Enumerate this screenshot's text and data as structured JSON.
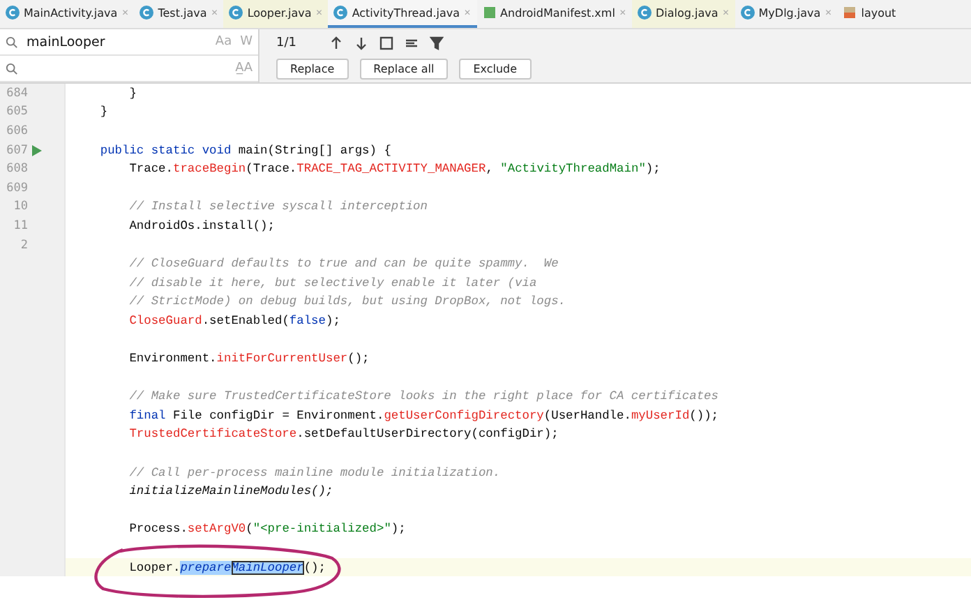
{
  "tabs": [
    {
      "label": "MainActivity.java",
      "kind": "class",
      "selected": false,
      "color": "#f2f2f2",
      "close": "✕"
    },
    {
      "label": "Test.java",
      "kind": "class",
      "selected": false,
      "color": "#f2f2f2",
      "close": "✕"
    },
    {
      "label": "Looper.java",
      "kind": "class",
      "selected": false,
      "color": "#f3f3dc",
      "close": "✕"
    },
    {
      "label": "ActivityThread.java",
      "kind": "class",
      "selected": true,
      "color": "#f6f6f6",
      "close": "✕"
    },
    {
      "label": "AndroidManifest.xml",
      "kind": "manifest",
      "selected": false,
      "color": "#f2f2f2",
      "close": "✕"
    },
    {
      "label": "Dialog.java",
      "kind": "class",
      "selected": false,
      "color": "#f3f3dc",
      "close": "✕"
    },
    {
      "label": "MyDlg.java",
      "kind": "class",
      "selected": false,
      "color": "#f2f2f2",
      "close": "✕"
    },
    {
      "label": "layout",
      "kind": "layout",
      "selected": false,
      "color": "#f2f2f2"
    }
  ],
  "find": {
    "value": "mainLooper",
    "count": "1/1",
    "options": [
      "Aa",
      "W"
    ]
  },
  "replace": {
    "options": [
      "A̲A"
    ],
    "buttons": [
      "Replace",
      "Replace all",
      "Exclude"
    ]
  },
  "lines": [
    {
      "kind": "code",
      "number": "684",
      "code": [
        {
          "text": "        }",
          "kind": "plain"
        }
      ]
    },
    {
      "kind": "code",
      "number": "605",
      "code": [
        {
          "text": "    }",
          "kind": "plain"
        }
      ]
    },
    {
      "kind": "blank",
      "number": "606"
    },
    {
      "kind": "code",
      "number": "607",
      "runnable": true,
      "code": [
        {
          "text": "    public static void ",
          "kind": "keyword"
        },
        {
          "text": "main(String[] args) {",
          "kind": "plain"
        }
      ]
    },
    {
      "kind": "code",
      "number": "608",
      "code": [
        {
          "text": "        Trace.",
          "kind": "plain"
        },
        {
          "text": "traceBegin",
          "kind": "method"
        },
        {
          "text": "(Trace.",
          "kind": "plain"
        },
        {
          "text": "TRACE_TAG_ACTIVITY_MANAGER",
          "kind": "method"
        },
        {
          "text": ", ",
          "kind": "plain"
        },
        {
          "text": "\"ActivityThreadMain\"",
          "kind": "string"
        },
        {
          "text": ");",
          "kind": "plain"
        }
      ]
    },
    {
      "kind": "blank",
      "number": "609"
    },
    {
      "kind": "code",
      "number": "10",
      "code": [
        {
          "text": "        // Install selective syscall interception",
          "kind": "comment"
        }
      ]
    },
    {
      "kind": "code",
      "number": "11",
      "code": [
        {
          "text": "        AndroidOs.install();",
          "kind": "plain"
        }
      ]
    },
    {
      "kind": "blank",
      "number": "2"
    },
    {
      "kind": "code",
      "code": [
        {
          "text": "        // CloseGuard defaults to true and can be quite spammy.  We",
          "kind": "comment"
        }
      ]
    },
    {
      "kind": "code",
      "code": [
        {
          "text": "        // disable it here, but selectively enable it later (via",
          "kind": "comment"
        }
      ]
    },
    {
      "kind": "code",
      "code": [
        {
          "text": "        // StrictMode) on debug builds, but using DropBox, not logs.",
          "kind": "comment"
        }
      ]
    },
    {
      "kind": "code",
      "code": [
        {
          "text": "        CloseGuard",
          "kind": "method"
        },
        {
          "text": ".setEnabled(",
          "kind": "plain"
        },
        {
          "text": "false",
          "kind": "keyword"
        },
        {
          "text": ");",
          "kind": "plain"
        }
      ]
    },
    {
      "kind": "blank"
    },
    {
      "kind": "code",
      "code": [
        {
          "text": "        Environment.",
          "kind": "plain"
        },
        {
          "text": "initForCurrentUser",
          "kind": "method"
        },
        {
          "text": "();",
          "kind": "plain"
        }
      ]
    },
    {
      "kind": "blank"
    },
    {
      "kind": "code",
      "code": [
        {
          "text": "        // Make sure TrustedCertificateStore looks in the right place for CA certificates",
          "kind": "comment"
        }
      ]
    },
    {
      "kind": "code",
      "code": [
        {
          "text": "        final ",
          "kind": "keyword"
        },
        {
          "text": "File configDir = Environment.",
          "kind": "plain"
        },
        {
          "text": "getUserConfigDirectory",
          "kind": "method"
        },
        {
          "text": "(UserHandle.",
          "kind": "plain"
        },
        {
          "text": "myUserId",
          "kind": "method"
        },
        {
          "text": "());",
          "kind": "plain"
        }
      ]
    },
    {
      "kind": "code",
      "code": [
        {
          "text": "        TrustedCertificateStore",
          "kind": "method"
        },
        {
          "text": ".setDefaultUserDirectory(configDir);",
          "kind": "plain"
        }
      ]
    },
    {
      "kind": "blank"
    },
    {
      "kind": "code",
      "code": [
        {
          "text": "        // Call per-process mainline module initialization.",
          "kind": "comment"
        }
      ]
    },
    {
      "kind": "code",
      "code": [
        {
          "text": "        initializeMainlineModules();",
          "kind": "static"
        }
      ]
    },
    {
      "kind": "blank"
    },
    {
      "kind": "code",
      "code": [
        {
          "text": "        Process.",
          "kind": "plain"
        },
        {
          "text": "setArgV0",
          "kind": "method"
        },
        {
          "text": "(",
          "kind": "plain"
        },
        {
          "text": "\"<pre-initialized>\"",
          "kind": "string"
        },
        {
          "text": ");",
          "kind": "plain"
        }
      ]
    },
    {
      "kind": "blank"
    },
    {
      "kind": "code",
      "current": true,
      "code": [
        {
          "text": "        Looper.",
          "kind": "plain"
        },
        {
          "text": "prepare",
          "kind": "selection"
        },
        {
          "text": "MainLooper",
          "kind": "match"
        },
        {
          "text": "();",
          "kind": "plain"
        }
      ]
    }
  ]
}
